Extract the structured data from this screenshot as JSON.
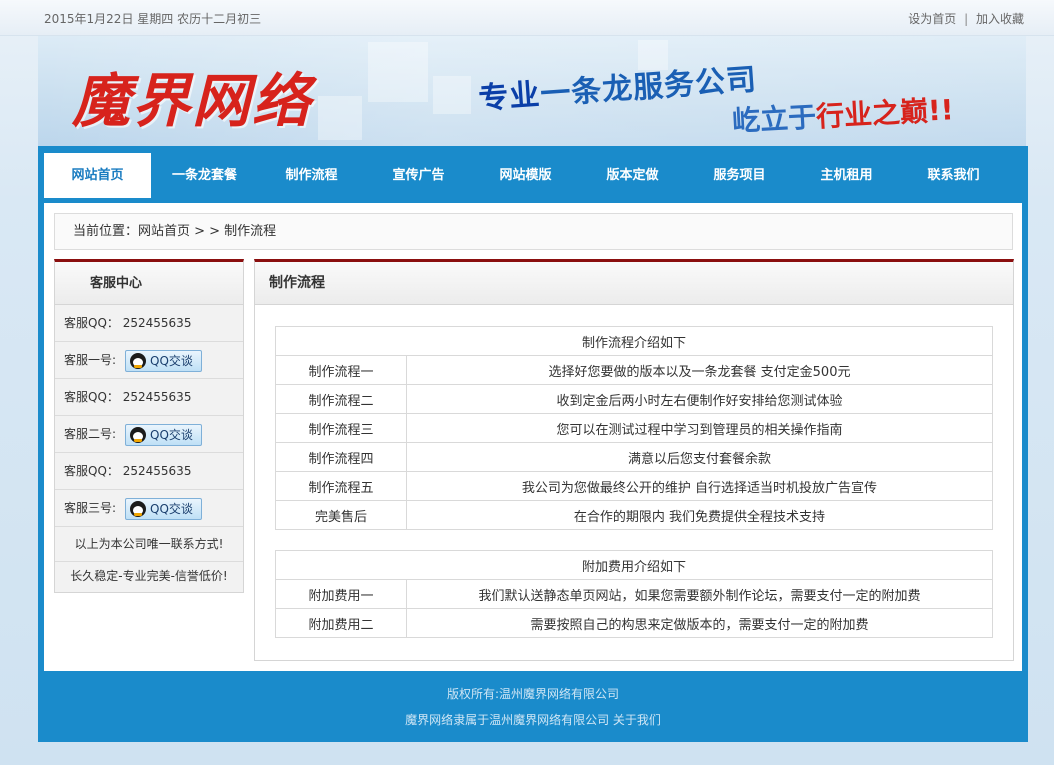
{
  "topbar": {
    "date": "2015年1月22日 星期四 农历十二月初三",
    "set_home": "设为首页",
    "separator": "|",
    "add_favorite": "加入收藏"
  },
  "banner": {
    "logo": "魔界网络",
    "slogan_part1": "专业",
    "slogan_part2": "一条龙服务公司",
    "slogan2_part1": "屹立于",
    "slogan2_part2": "行业之巅",
    "slogan2_part3": "!!"
  },
  "nav": [
    {
      "label": "网站首页",
      "active": true
    },
    {
      "label": "一条龙套餐",
      "active": false
    },
    {
      "label": "制作流程",
      "active": false
    },
    {
      "label": "宣传广告",
      "active": false
    },
    {
      "label": "网站模版",
      "active": false
    },
    {
      "label": "版本定做",
      "active": false
    },
    {
      "label": "服务项目",
      "active": false
    },
    {
      "label": "主机租用",
      "active": false
    },
    {
      "label": "联系我们",
      "active": false
    }
  ],
  "breadcrumb": "当前位置：网站首页 > > 制作流程",
  "sidebar": {
    "title": "客服中心",
    "rows": [
      {
        "label": "客服QQ：",
        "value": "252455635",
        "type": "text"
      },
      {
        "label": "客服一号:",
        "value": "QQ交谈",
        "type": "button"
      },
      {
        "label": "客服QQ：",
        "value": "252455635",
        "type": "text"
      },
      {
        "label": "客服二号:",
        "value": "QQ交谈",
        "type": "button"
      },
      {
        "label": "客服QQ：",
        "value": "252455635",
        "type": "text"
      },
      {
        "label": "客服三号:",
        "value": "QQ交谈",
        "type": "button"
      }
    ],
    "note": "以上为本公司唯一联系方式!",
    "footer": "长久稳定-专业完美-信誉低价!"
  },
  "main": {
    "title": "制作流程",
    "table1": {
      "header": "制作流程介绍如下",
      "rows": [
        [
          "制作流程一",
          "选择好您要做的版本以及一条龙套餐 支付定金500元"
        ],
        [
          "制作流程二",
          "收到定金后两小时左右便制作好安排给您测试体验"
        ],
        [
          "制作流程三",
          "您可以在测试过程中学习到管理员的相关操作指南"
        ],
        [
          "制作流程四",
          "满意以后您支付套餐余款"
        ],
        [
          "制作流程五",
          "我公司为您做最终公开的维护 自行选择适当时机投放广告宣传"
        ],
        [
          "完美售后",
          "在合作的期限内 我们免费提供全程技术支持"
        ]
      ]
    },
    "table2": {
      "header": "附加费用介绍如下",
      "rows": [
        [
          "附加费用一",
          "我们默认送静态单页网站，如果您需要额外制作论坛，需要支付一定的附加费"
        ],
        [
          "附加费用二",
          "需要按照自己的构思来定做版本的，需要支付一定的附加费"
        ]
      ]
    }
  },
  "footer": {
    "copyright": "版权所有:温州魔界网络有限公司",
    "line2_text": "魔界网络隶属于温州魔界网络有限公司",
    "about": "关于我们"
  }
}
